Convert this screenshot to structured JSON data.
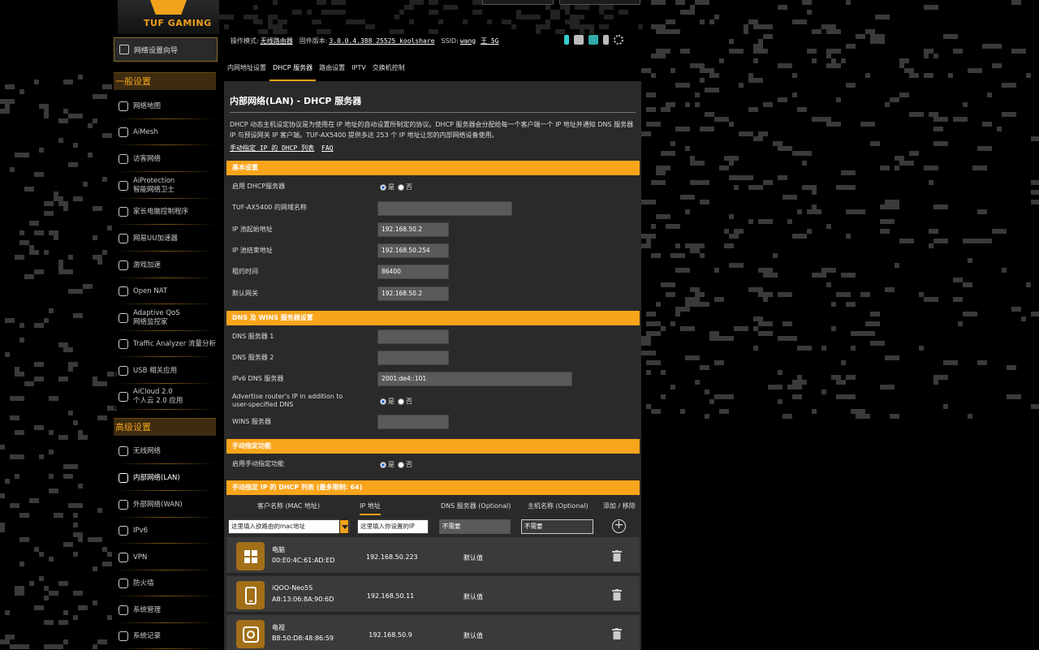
{
  "brand": {
    "logo_text": "TUF GAMING"
  },
  "sidebar": {
    "wizard_label": "网络设置向导",
    "general_header": "一般设置",
    "general_items": [
      {
        "label": "网络地图",
        "icon": "network-map-icon"
      },
      {
        "label": "AiMesh",
        "icon": "aimesh-icon"
      },
      {
        "label": "访客网络",
        "icon": "guest-network-icon"
      },
      {
        "label": "AiProtection",
        "label2": "智能网络卫士",
        "icon": "shield-icon"
      },
      {
        "label": "家长电脑控制程序",
        "icon": "parental-control-icon"
      },
      {
        "label": "网易UU加速器",
        "icon": "uu-booster-icon"
      },
      {
        "label": "游戏加速",
        "icon": "game-boost-icon"
      },
      {
        "label": "Open NAT",
        "icon": "open-nat-icon"
      },
      {
        "label": "Adaptive QoS",
        "label2": "网络监控家",
        "icon": "qos-icon"
      },
      {
        "label": "Traffic Analyzer 流量分析",
        "icon": "traffic-analyzer-icon"
      },
      {
        "label": "USB 相关应用",
        "icon": "usb-icon"
      },
      {
        "label": "AiCloud 2.0",
        "label2": "个人云 2.0 应用",
        "icon": "cloud-icon"
      }
    ],
    "advanced_header": "高级设置",
    "advanced_items": [
      {
        "label": "无线网络",
        "icon": "wireless-icon"
      },
      {
        "label": "内部网络(LAN)",
        "icon": "lan-icon",
        "active": true
      },
      {
        "label": "外部网络(WAN)",
        "icon": "wan-icon"
      },
      {
        "label": "IPv6",
        "icon": "ipv6-icon"
      },
      {
        "label": "VPN",
        "icon": "vpn-icon"
      },
      {
        "label": "防火墙",
        "icon": "firewall-icon"
      },
      {
        "label": "系统管理",
        "icon": "admin-icon"
      },
      {
        "label": "系统记录",
        "icon": "log-icon"
      }
    ]
  },
  "header": {
    "mode_label": "操作模式:",
    "mode_value": "无线路由器",
    "fw_label": "固件版本:",
    "fw_value": "3.0.0.4.388_25525_koolshare",
    "ssid_label": "SSID:",
    "ssid_1": "wang",
    "ssid_2": "王_5G"
  },
  "tabs": [
    {
      "label": "内网地址设置",
      "active": false
    },
    {
      "label": "DHCP 服务器",
      "active": true
    },
    {
      "label": "路由设置",
      "active": false
    },
    {
      "label": "IPTV",
      "active": false
    },
    {
      "label": "交换机控制",
      "active": false
    }
  ],
  "page": {
    "title": "内部网络(LAN) - DHCP 服务器",
    "desc": "DHCP 动态主机设定协议是为使用在 IP 地址的自动设置所制定的协议。DHCP 服务器会分配给每一个客户端一个 IP 地址并通知 DNS 服务器 IP 与预设网关 IP 客户端。TUF-AX5400 提供多达 253 个 IP 地址让您的内部网络设备使用。",
    "link_1": "手动指定 IP 的 DHCP 列表",
    "link_2": "FAQ"
  },
  "basic": {
    "header": "基本设置",
    "enable_label": "启用 DHCP服务器",
    "yes": "是",
    "no": "否",
    "domain_label": "TUF-AX5400 的网域名称",
    "domain_value": "",
    "start_label": "IP 池起始地址",
    "start_value": "192.168.50.2",
    "end_label": "IP 池结束地址",
    "end_value": "192.168.50.254",
    "lease_label": "租约时间",
    "lease_value": "86400",
    "gateway_label": "默认网关",
    "gateway_value": "192.168.50.2"
  },
  "dns": {
    "header": "DNS 及 WINS 服务器设置",
    "dns1_label": "DNS 服务器 1",
    "dns1_value": "",
    "dns2_label": "DNS 服务器 2",
    "dns2_value": "",
    "ipv6dns_label": "IPv6 DNS 服务器",
    "ipv6dns_value": "2001:de4::101",
    "advertise_label": "Advertise router's IP in addition to user-specified DNS",
    "wins_label": "WINS 服务器",
    "wins_value": ""
  },
  "manual": {
    "header": "手动指定功能",
    "enable_label": "启用手动指定功能"
  },
  "list": {
    "header": "手动指定 IP 的 DHCP 列表 (最多限制: 64)",
    "col_name": "客户名称 (MAC 地址)",
    "col_ip": "IP 地址",
    "col_dns": "DNS 服务器 (Optional)",
    "col_host": "主机名称 (Optional)",
    "col_action": "添加 / 移除",
    "mac_placeholder": "这里填入欲路由的mac地址",
    "ip_placeholder": "这里填入你设置的IP",
    "dns_placeholder": "不需要",
    "host_placeholder": "不需要",
    "clients": [
      {
        "name": "电脑",
        "mac": "00:E0:4C:61:AD:ED",
        "ip": "192.168.50.223",
        "dns": "默认值",
        "icon": "windows-icon"
      },
      {
        "name": "iQOO-Neo5S",
        "mac": "A8:13:06:8A:90:6D",
        "ip": "192.168.50.11",
        "dns": "默认值",
        "icon": "phone-icon"
      },
      {
        "name": "电视",
        "mac": "B8:50:D8:48:86:59",
        "ip": "192.168.50.9",
        "dns": "默认值",
        "icon": "tv-icon"
      }
    ]
  }
}
